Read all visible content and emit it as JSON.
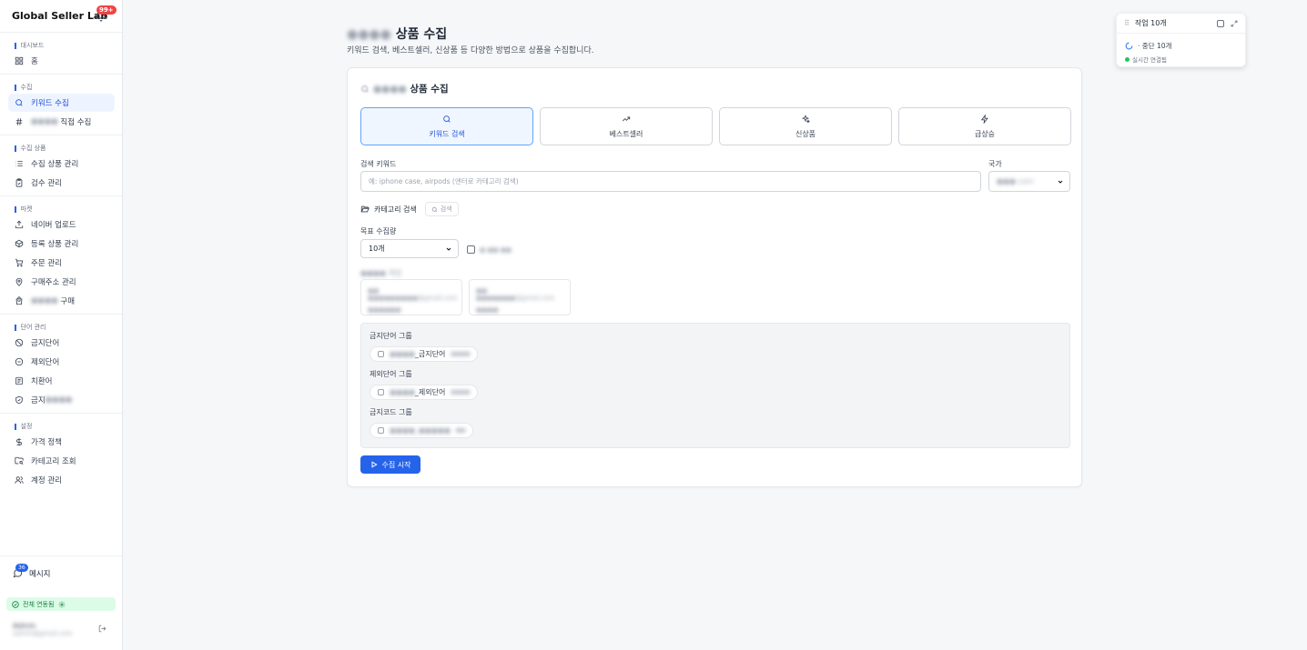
{
  "sidebar": {
    "brand": "Global Seller Lab",
    "bell_badge": "99+",
    "sections": [
      {
        "label": "대시보드",
        "items": [
          {
            "label": "홈",
            "icon": "grid-icon"
          }
        ]
      },
      {
        "label": "수집",
        "items": [
          {
            "label": "키워드 수집",
            "icon": "search-icon",
            "active": true
          },
          {
            "label": "직접 수집",
            "prefix": "●●●●",
            "icon": "hash-icon"
          }
        ]
      },
      {
        "label": "수집 상품",
        "items": [
          {
            "label": "수집 상품 관리",
            "icon": "list-icon"
          },
          {
            "label": "검수 관리",
            "icon": "clipboard-check-icon"
          }
        ]
      },
      {
        "label": "마켓",
        "items": [
          {
            "label": "네이버 업로드",
            "icon": "upload-icon"
          },
          {
            "label": "등록 상품 관리",
            "icon": "box-icon"
          },
          {
            "label": "주문 관리",
            "icon": "cart-icon"
          },
          {
            "label": "구매주소 관리",
            "icon": "map-pin-icon"
          },
          {
            "label": "구매",
            "prefix": "●●●●",
            "icon": "bag-icon"
          }
        ]
      },
      {
        "label": "단어 관리",
        "items": [
          {
            "label": "금지단어",
            "icon": "ban-icon"
          },
          {
            "label": "제외단어",
            "icon": "minus-circle-icon"
          },
          {
            "label": "치환어",
            "icon": "replace-icon"
          },
          {
            "label": "금지",
            "suffix": "●●●●",
            "icon": "shield-icon"
          }
        ]
      },
      {
        "label": "설정",
        "items": [
          {
            "label": "가격 정책",
            "icon": "dollar-icon"
          },
          {
            "label": "카테고리 조회",
            "icon": "folder-search-icon"
          },
          {
            "label": "계정 관리",
            "icon": "users-icon"
          }
        ]
      }
    ],
    "message_label": "메시지",
    "message_badge": "36",
    "sync_label": "전체 연동됨",
    "user_name": "Admin",
    "user_email": "admin@gmail.com"
  },
  "page": {
    "title_prefix": "●●●●",
    "title": "상품 수집",
    "subtitle": "키워드 검색, 베스트셀러, 신상품 등 다양한 방법으로 상품을 수집합니다."
  },
  "card": {
    "title_prefix": "●●●●",
    "title": "상품 수집",
    "modes": [
      {
        "label": "키워드 검색",
        "icon": "search-icon"
      },
      {
        "label": "베스트셀러",
        "icon": "trending-up-icon"
      },
      {
        "label": "신상품",
        "icon": "sparkles-icon"
      },
      {
        "label": "급상승",
        "icon": "zap-icon"
      }
    ],
    "keyword_label": "검색 키워드",
    "keyword_placeholder": "예: iphone case, airpods (엔터로 카테고리 검색)",
    "country_label": "국가",
    "country_value": "●●● com",
    "category_label": "카테고리 검색",
    "category_btn": "검색",
    "target_label": "목표 수집량",
    "target_value": "10개",
    "checkbox_label": "● ●● ●●",
    "account_label": "●●●● 계정",
    "accounts": [
      {
        "line1": "●● ●●●●●●●●●@gmail.com",
        "line2": "●●●●●●"
      },
      {
        "line1": "●● ●●●●●●●@gmail.com",
        "line2": "●●●●"
      }
    ],
    "groups": [
      {
        "label": "금지단어 그룹",
        "chip_prefix": "●●●●",
        "chip": "_금지단어",
        "count": "●●●●"
      },
      {
        "label": "제외단어 그룹",
        "chip_prefix": "●●●●",
        "chip": "_제외단어",
        "count": "●●●●"
      },
      {
        "label": "금지코드 그룹",
        "chip_prefix": "●●●●_●●●●●",
        "chip": "",
        "count": "●●"
      }
    ],
    "start_label": "수집 시작"
  },
  "task": {
    "title": "작업 10개",
    "row": "· 중단 10개",
    "status": "실시간 연결됨"
  },
  "colors": {
    "accent": "#2563eb",
    "sync_bg": "#dcfce7",
    "success": "#22c55e"
  }
}
